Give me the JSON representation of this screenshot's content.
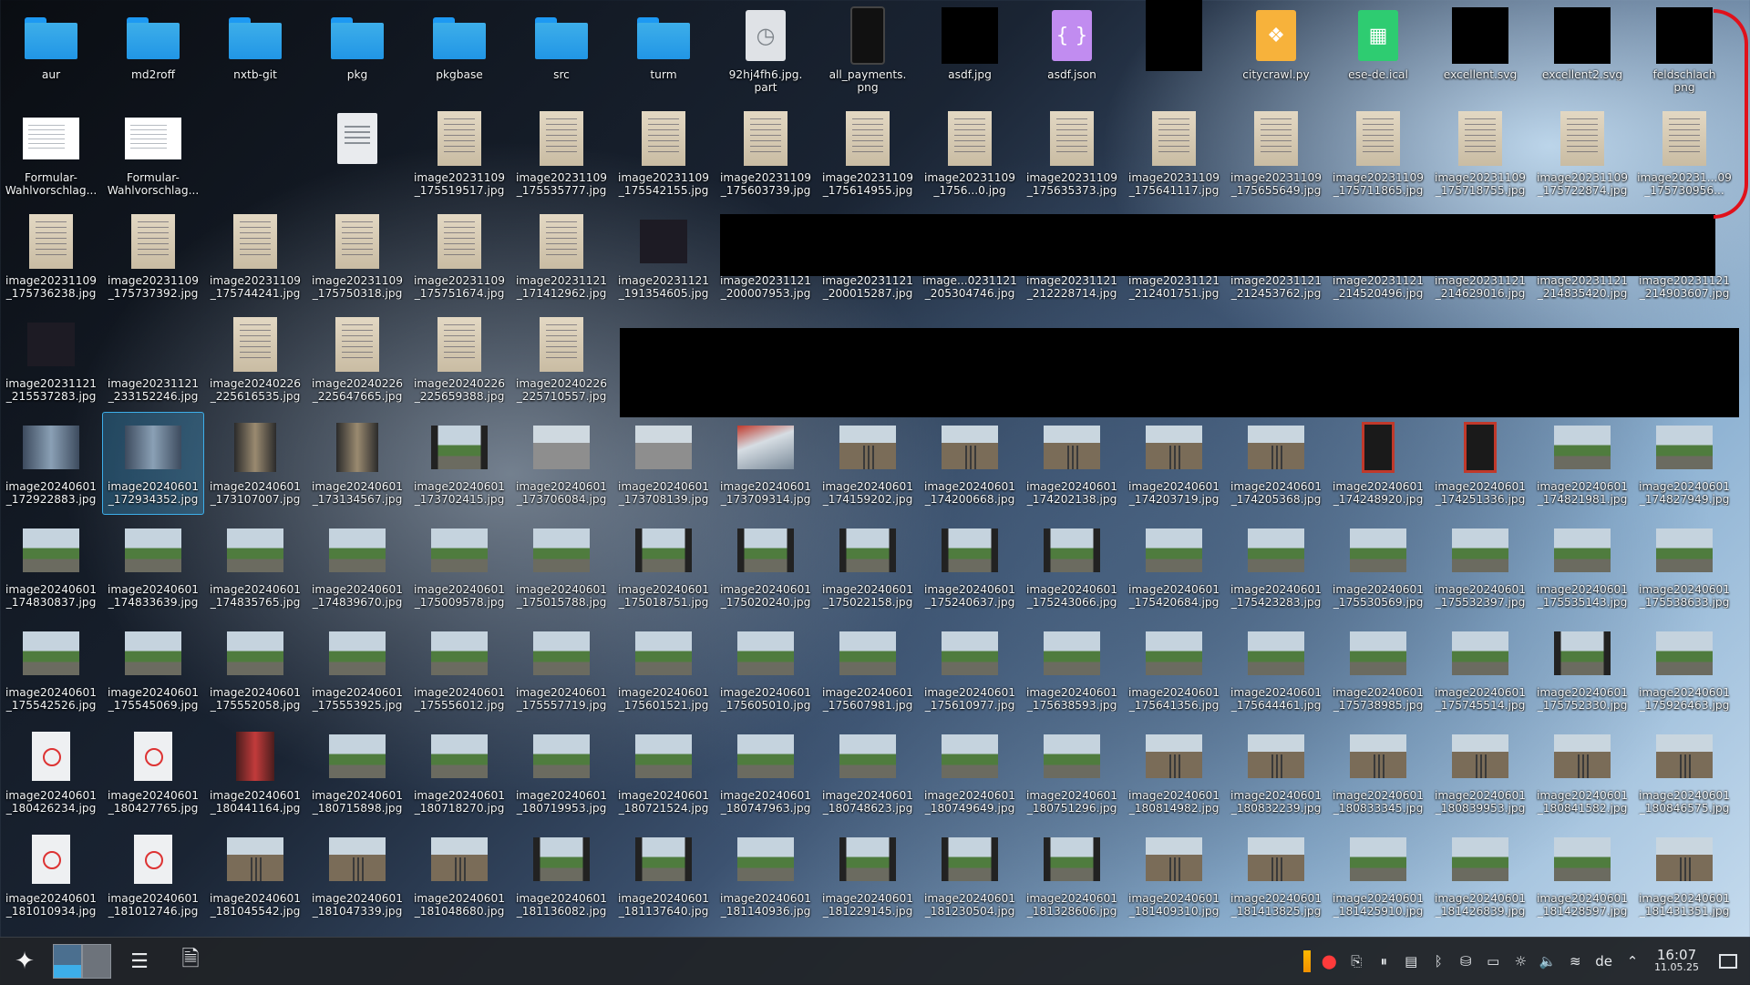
{
  "desktop": {
    "items": [
      {
        "label": "aur",
        "kind": "folder"
      },
      {
        "label": "md2roff",
        "kind": "folder"
      },
      {
        "label": "nxtb-git",
        "kind": "folder"
      },
      {
        "label": "pkg",
        "kind": "folder"
      },
      {
        "label": "pkgbase",
        "kind": "folder"
      },
      {
        "label": "src",
        "kind": "folder"
      },
      {
        "label": "turm",
        "kind": "folder"
      },
      {
        "label": "92hj4fh6.jpg.\npart",
        "kind": "clock"
      },
      {
        "label": "all_payments.\npng",
        "kind": "phone"
      },
      {
        "label": "asdf.jpg",
        "kind": "black"
      },
      {
        "label": "asdf.json",
        "kind": "json"
      },
      {
        "label": "",
        "kind": "black-tall"
      },
      {
        "label": "citycrawl.py",
        "kind": "py"
      },
      {
        "label": "ese-de.ical",
        "kind": "ical"
      },
      {
        "label": "excellent.svg",
        "kind": "black"
      },
      {
        "label": "excellent2.svg",
        "kind": "black"
      },
      {
        "label": "feldschlach\npng",
        "kind": "black"
      },
      {
        "label": "Formular-\nWahlvorschlag...",
        "kind": "form"
      },
      {
        "label": "Formular-\nWahlvorschlag...",
        "kind": "form"
      },
      {
        "label": "",
        "kind": "blank"
      },
      {
        "label": "",
        "kind": "file"
      },
      {
        "label": "image20231109\n_175519517.jpg",
        "kind": "paper"
      },
      {
        "label": "image20231109\n_175535777.jpg",
        "kind": "paper"
      },
      {
        "label": "image20231109\n_175542155.jpg",
        "kind": "paper"
      },
      {
        "label": "image20231109\n_175603739.jpg",
        "kind": "paper"
      },
      {
        "label": "image20231109\n_175614955.jpg",
        "kind": "paper"
      },
      {
        "label": "image20231109\n_1756...0.jpg",
        "kind": "paper"
      },
      {
        "label": "image20231109\n_175635373.jpg",
        "kind": "paper"
      },
      {
        "label": "image20231109\n_175641117.jpg",
        "kind": "paper"
      },
      {
        "label": "image20231109\n_175655649.jpg",
        "kind": "paper"
      },
      {
        "label": "image20231109\n_175711865.jpg",
        "kind": "paper"
      },
      {
        "label": "image20231109\n_175718755.jpg",
        "kind": "paper"
      },
      {
        "label": "image20231109\n_175722874.jpg",
        "kind": "paper"
      },
      {
        "label": "image20231...09\n_175730956...",
        "kind": "paper"
      },
      {
        "label": "image20231109\n_175736238.jpg",
        "kind": "paper"
      },
      {
        "label": "image20231109\n_175737392.jpg",
        "kind": "paper"
      },
      {
        "label": "image20231109\n_175744241.jpg",
        "kind": "paper"
      },
      {
        "label": "image20231109\n_175750318.jpg",
        "kind": "paper"
      },
      {
        "label": "image20231109\n_175751674.jpg",
        "kind": "paper"
      },
      {
        "label": "image20231121\n_171412962.jpg",
        "kind": "paper"
      },
      {
        "label": "image20231121\n_191354605.jpg",
        "kind": "dark"
      },
      {
        "label": "image20231121\n_200007953.jpg",
        "kind": "blank"
      },
      {
        "label": "image20231121\n_200015287.jpg",
        "kind": "blank"
      },
      {
        "label": "image...0231121\n_205304746.jpg",
        "kind": "blank"
      },
      {
        "label": "image20231121\n_212228714.jpg",
        "kind": "blank"
      },
      {
        "label": "image20231121\n_212401751.jpg",
        "kind": "blank"
      },
      {
        "label": "image20231121\n_212453762.jpg",
        "kind": "blank"
      },
      {
        "label": "image20231121\n_214520496.jpg",
        "kind": "blank"
      },
      {
        "label": "image20231121\n_214629016.jpg",
        "kind": "blank"
      },
      {
        "label": "image20231121\n_214835420.jpg",
        "kind": "blank"
      },
      {
        "label": "image20231121\n_214903607.jpg",
        "kind": "blank"
      },
      {
        "label": "image20231121\n_215537283.jpg",
        "kind": "dark"
      },
      {
        "label": "image20231121\n_233152246.jpg",
        "kind": "blank"
      },
      {
        "label": "image20240226\n_225616535.jpg",
        "kind": "paper"
      },
      {
        "label": "image20240226\n_225647665.jpg",
        "kind": "paper"
      },
      {
        "label": "image20240226\n_225659388.jpg",
        "kind": "paper"
      },
      {
        "label": "image20240226\n_225710557.jpg",
        "kind": "paper"
      },
      {
        "label": "",
        "kind": "blank"
      },
      {
        "label": "",
        "kind": "blank"
      },
      {
        "label": "",
        "kind": "blank"
      },
      {
        "label": "",
        "kind": "blank"
      },
      {
        "label": "",
        "kind": "blank"
      },
      {
        "label": "",
        "kind": "blank"
      },
      {
        "label": "",
        "kind": "blank"
      },
      {
        "label": "",
        "kind": "blank"
      },
      {
        "label": "",
        "kind": "blank"
      },
      {
        "label": "",
        "kind": "blank"
      },
      {
        "label": "",
        "kind": "blank"
      },
      {
        "label": "image20240601\n_172922883.jpg",
        "kind": "train-in"
      },
      {
        "label": "image20240601\n_172934352.jpg",
        "kind": "train-in",
        "selected": true
      },
      {
        "label": "image20240601\n_173107007.jpg",
        "kind": "corridor"
      },
      {
        "label": "image20240601\n_173134567.jpg",
        "kind": "corridor"
      },
      {
        "label": "image20240601\n_173702415.jpg",
        "kind": "window-frame"
      },
      {
        "label": "image20240601\n_173706084.jpg",
        "kind": "station"
      },
      {
        "label": "image20240601\n_173708139.jpg",
        "kind": "station"
      },
      {
        "label": "image20240601\n_173709314.jpg",
        "kind": "motion"
      },
      {
        "label": "image20240601\n_174159202.jpg",
        "kind": "track"
      },
      {
        "label": "image20240601\n_174200668.jpg",
        "kind": "track"
      },
      {
        "label": "image20240601\n_174202138.jpg",
        "kind": "track"
      },
      {
        "label": "image20240601\n_174203719.jpg",
        "kind": "track"
      },
      {
        "label": "image20240601\n_174205368.jpg",
        "kind": "track"
      },
      {
        "label": "image20240601\n_174248920.jpg",
        "kind": "red-door"
      },
      {
        "label": "image20240601\n_174251336.jpg",
        "kind": "red-door"
      },
      {
        "label": "image20240601\n_174821981.jpg",
        "kind": "window"
      },
      {
        "label": "image20240601\n_174827949.jpg",
        "kind": "window"
      },
      {
        "label": "image20240601\n_174830837.jpg",
        "kind": "window"
      },
      {
        "label": "image20240601\n_174833639.jpg",
        "kind": "window"
      },
      {
        "label": "image20240601\n_174835765.jpg",
        "kind": "window"
      },
      {
        "label": "image20240601\n_174839670.jpg",
        "kind": "window"
      },
      {
        "label": "image20240601\n_175009578.jpg",
        "kind": "window"
      },
      {
        "label": "image20240601\n_175015788.jpg",
        "kind": "window"
      },
      {
        "label": "image20240601\n_175018751.jpg",
        "kind": "window-frame"
      },
      {
        "label": "image20240601\n_175020240.jpg",
        "kind": "window-frame"
      },
      {
        "label": "image20240601\n_175022158.jpg",
        "kind": "window-frame"
      },
      {
        "label": "image20240601\n_175240637.jpg",
        "kind": "window-frame"
      },
      {
        "label": "image20240601\n_175243066.jpg",
        "kind": "window-frame"
      },
      {
        "label": "image20240601\n_175420684.jpg",
        "kind": "window"
      },
      {
        "label": "image20240601\n_175423283.jpg",
        "kind": "window"
      },
      {
        "label": "image20240601\n_175530569.jpg",
        "kind": "window"
      },
      {
        "label": "image20240601\n_175532397.jpg",
        "kind": "window"
      },
      {
        "label": "image20240601\n_175535143.jpg",
        "kind": "window"
      },
      {
        "label": "image20240601\n_175538633.jpg",
        "kind": "window"
      },
      {
        "label": "image20240601\n_175542526.jpg",
        "kind": "window"
      },
      {
        "label": "image20240601\n_175545069.jpg",
        "kind": "window"
      },
      {
        "label": "image20240601\n_175552058.jpg",
        "kind": "window"
      },
      {
        "label": "image20240601\n_175553925.jpg",
        "kind": "window"
      },
      {
        "label": "image20240601\n_175556012.jpg",
        "kind": "window"
      },
      {
        "label": "image20240601\n_175557719.jpg",
        "kind": "window"
      },
      {
        "label": "image20240601\n_175601521.jpg",
        "kind": "window"
      },
      {
        "label": "image20240601\n_175605010.jpg",
        "kind": "window"
      },
      {
        "label": "image20240601\n_175607981.jpg",
        "kind": "window"
      },
      {
        "label": "image20240601\n_175610977.jpg",
        "kind": "window"
      },
      {
        "label": "image20240601\n_175638593.jpg",
        "kind": "window"
      },
      {
        "label": "image20240601\n_175641356.jpg",
        "kind": "window"
      },
      {
        "label": "image20240601\n_175644461.jpg",
        "kind": "window"
      },
      {
        "label": "image20240601\n_175738985.jpg",
        "kind": "window"
      },
      {
        "label": "image20240601\n_175745514.jpg",
        "kind": "window"
      },
      {
        "label": "image20240601\n_175752330.jpg",
        "kind": "window-frame"
      },
      {
        "label": "image20240601\n_175926463.jpg",
        "kind": "window"
      },
      {
        "label": "image20240601\n_180426234.jpg",
        "kind": "sign"
      },
      {
        "label": "image20240601\n_180427765.jpg",
        "kind": "sign"
      },
      {
        "label": "image20240601\n_180441164.jpg",
        "kind": "door"
      },
      {
        "label": "image20240601\n_180715898.jpg",
        "kind": "window"
      },
      {
        "label": "image20240601\n_180718270.jpg",
        "kind": "window"
      },
      {
        "label": "image20240601\n_180719953.jpg",
        "kind": "window"
      },
      {
        "label": "image20240601\n_180721524.jpg",
        "kind": "window"
      },
      {
        "label": "image20240601\n_180747963.jpg",
        "kind": "window"
      },
      {
        "label": "image20240601\n_180748623.jpg",
        "kind": "window"
      },
      {
        "label": "image20240601\n_180749649.jpg",
        "kind": "window"
      },
      {
        "label": "image20240601\n_180751296.jpg",
        "kind": "window"
      },
      {
        "label": "image20240601\n_180814982.jpg",
        "kind": "track"
      },
      {
        "label": "image20240601\n_180832239.jpg",
        "kind": "track"
      },
      {
        "label": "image20240601\n_180833345.jpg",
        "kind": "track"
      },
      {
        "label": "image20240601\n_180839953.jpg",
        "kind": "track"
      },
      {
        "label": "image20240601\n_180841582.jpg",
        "kind": "track"
      },
      {
        "label": "image20240601\n_180846575.jpg",
        "kind": "track"
      },
      {
        "label": "image20240601\n_181010934.jpg",
        "kind": "sign"
      },
      {
        "label": "image20240601\n_181012746.jpg",
        "kind": "sign"
      },
      {
        "label": "image20240601\n_181045542.jpg",
        "kind": "track"
      },
      {
        "label": "image20240601\n_181047339.jpg",
        "kind": "track"
      },
      {
        "label": "image20240601\n_181048680.jpg",
        "kind": "track"
      },
      {
        "label": "image20240601\n_181136082.jpg",
        "kind": "window-frame"
      },
      {
        "label": "image20240601\n_181137640.jpg",
        "kind": "window-frame"
      },
      {
        "label": "image20240601\n_181140936.jpg",
        "kind": "window"
      },
      {
        "label": "image20240601\n_181229145.jpg",
        "kind": "window-frame"
      },
      {
        "label": "image20240601\n_181230504.jpg",
        "kind": "window-frame"
      },
      {
        "label": "image20240601\n_181328606.jpg",
        "kind": "window-frame"
      },
      {
        "label": "image20240601\n_181409310.jpg",
        "kind": "track"
      },
      {
        "label": "image20240601\n_181413825.jpg",
        "kind": "track"
      },
      {
        "label": "image20240601\n_181425910.jpg",
        "kind": "window"
      },
      {
        "label": "image20240601\n_181426839.jpg",
        "kind": "window"
      },
      {
        "label": "image20240601\n_181428597.jpg",
        "kind": "window"
      },
      {
        "label": "image20240601\n_181431351.jpg",
        "kind": "track"
      }
    ]
  },
  "taskbar": {
    "language": "de",
    "time": "16:07",
    "date": "11.05.25",
    "icons": {
      "launcher": "application-launcher-icon",
      "settings_task": "system-settings-icon",
      "file_task": "document-icon"
    }
  }
}
